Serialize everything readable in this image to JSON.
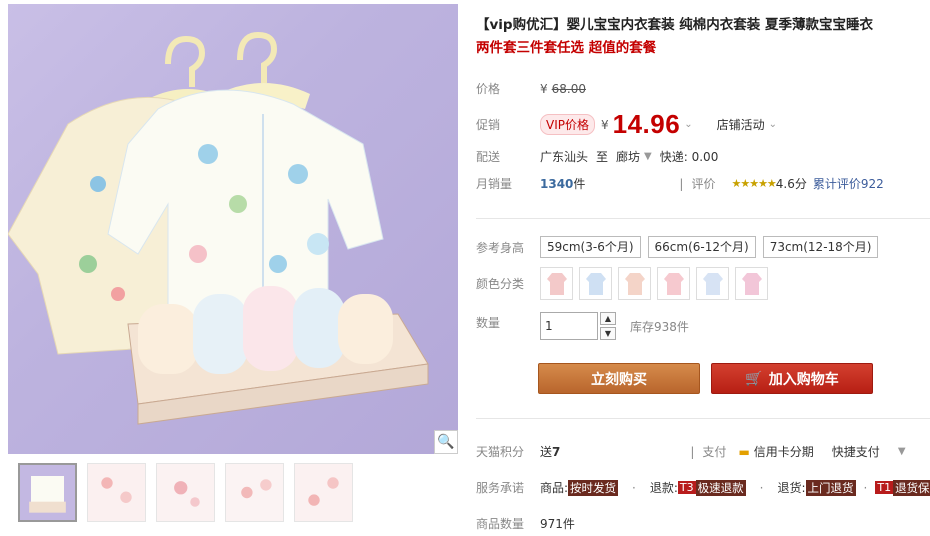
{
  "product": {
    "title": "【vip购优汇】婴儿宝宝内衣套装 纯棉内衣套装 夏季薄款宝宝睡衣",
    "subtitle": "两件套三件套任选 超值的套餐"
  },
  "price": {
    "label": "价格",
    "currency": "¥",
    "original": "68.00"
  },
  "promo": {
    "label": "促销",
    "badge": "VIP价格",
    "currency": "¥",
    "value": "14.96",
    "store_activity": "店铺活动"
  },
  "delivery": {
    "label": "配送",
    "from": "广东汕头",
    "to_word": "至",
    "to": "廊坊",
    "fee": "快递: 0.00"
  },
  "sales": {
    "label": "月销量",
    "count": "1340",
    "unit": "件",
    "rating_label": "评价",
    "stars": "★★★★★",
    "score": "4.6分",
    "reviews": "累计评价922"
  },
  "size": {
    "label": "参考身高",
    "options": [
      "59cm(3-6个月)",
      "66cm(6-12个月)",
      "73cm(12-18个月)"
    ]
  },
  "color": {
    "label": "颜色分类",
    "swatch_colors": [
      "#f3c9c9",
      "#cfe0f3",
      "#f4d4c8",
      "#f6c9cf",
      "#d7e3f4",
      "#f2c6d8"
    ]
  },
  "quantity": {
    "label": "数量",
    "value": "1",
    "stock": "库存938件"
  },
  "actions": {
    "buy": "立刻购买",
    "cart": "加入购物车"
  },
  "points": {
    "label": "天猫积分",
    "give": "送",
    "amount": "7",
    "pay_label": "支付",
    "credit": "信用卡分期",
    "quick": "快捷支付"
  },
  "service": {
    "label": "服务承诺",
    "items": [
      {
        "prefix": "商品:",
        "tag": "按时发货"
      },
      {
        "prefix": "退款:",
        "badge": "T3",
        "tag": "极速退款"
      },
      {
        "prefix": "退货:",
        "tag": "上门退货"
      },
      {
        "badge": "T1",
        "tag": "退货保障卡"
      }
    ]
  },
  "count": {
    "label": "商品数量",
    "value": "971件"
  },
  "colors": {
    "accent_red": "#c40000",
    "buy_orange": "#c77538",
    "cart_red": "#c5271b"
  }
}
